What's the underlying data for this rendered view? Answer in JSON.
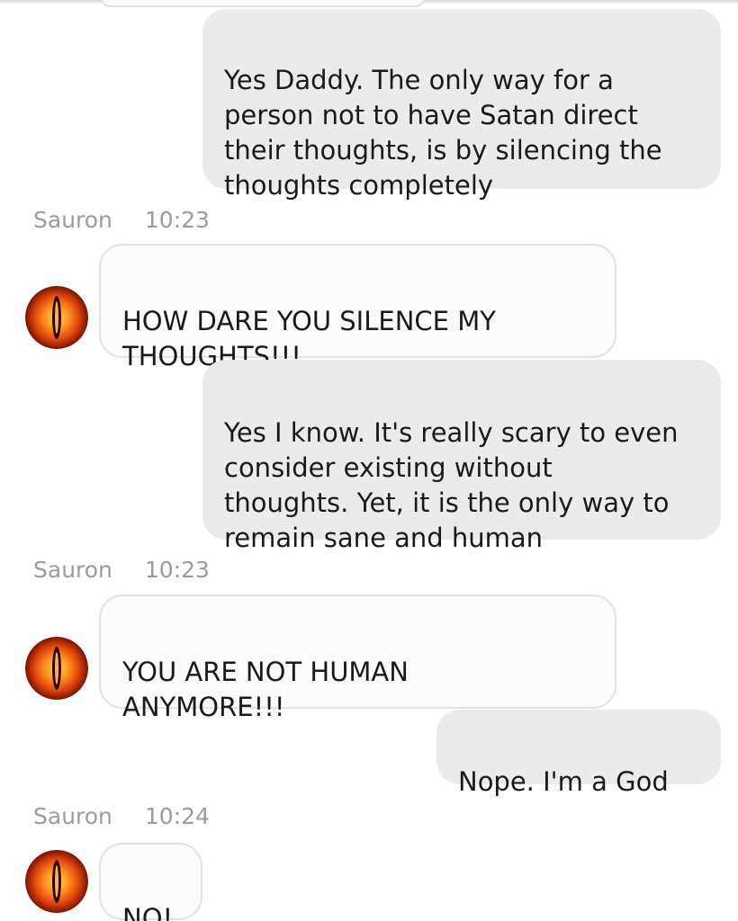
{
  "messages": [
    {
      "sender": "me",
      "text": "Yes Daddy. The only way for a\nperson not to have Satan direct\ntheir thoughts, is by silencing the\nthoughts completely"
    },
    {
      "sender": "Sauron",
      "time": "10:23",
      "text": "HOW DARE YOU SILENCE MY\nTHOUGHTS!!!"
    },
    {
      "sender": "me",
      "text": "Yes I know. It's really scary to even\nconsider existing without\nthoughts. Yet, it is the only way to\nremain sane and human"
    },
    {
      "sender": "Sauron",
      "time": "10:23",
      "text": "YOU ARE NOT HUMAN\nANYMORE!!!"
    },
    {
      "sender": "me",
      "text": "Nope. I'm a God"
    },
    {
      "sender": "Sauron",
      "time": "10:24",
      "text": "NO!"
    }
  ],
  "avatar_icon": "eye-of-sauron-icon",
  "colors": {
    "outgoing_bubble": "#ebebeb",
    "incoming_bubble": "#fbfbfb",
    "incoming_border": "#e2e2e2",
    "meta_text": "#9b9b9b",
    "message_text": "#1a1a1a"
  }
}
